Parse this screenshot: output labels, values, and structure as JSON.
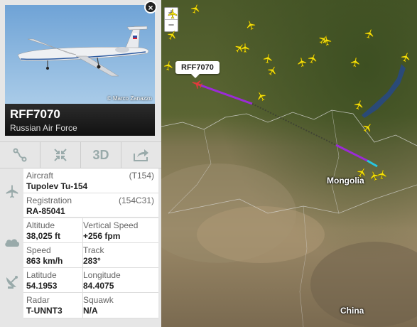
{
  "map": {
    "zoom_in": "+",
    "zoom_out": "−",
    "flight_label": "RFF7070",
    "countries": [
      {
        "name": "Mongolia"
      },
      {
        "name": "China"
      }
    ]
  },
  "panel": {
    "close": "×",
    "photo_credit": "© Marco Zanazzo",
    "callsign": "RFF7070",
    "airline": "Russian Air Force",
    "toolbar": {
      "route_icon": "route-icon",
      "fit_icon": "fit-view-icon",
      "three_d": "3D",
      "share_icon": "share-icon"
    },
    "aircraft": {
      "label": "Aircraft",
      "code": "(T154)",
      "value": "Tupolev Tu-154"
    },
    "registration": {
      "label": "Registration",
      "code": "(154C31)",
      "value": "RA-85041"
    },
    "altitude": {
      "label": "Altitude",
      "value": "38,025 ft"
    },
    "vertical_speed": {
      "label": "Vertical Speed",
      "value": "+256 fpm"
    },
    "speed": {
      "label": "Speed",
      "value": "863 km/h"
    },
    "track": {
      "label": "Track",
      "value": "283°"
    },
    "latitude": {
      "label": "Latitude",
      "value": "54.1953"
    },
    "longitude": {
      "label": "Longitude",
      "value": "84.4075"
    },
    "radar": {
      "label": "Radar",
      "value": "T-UNNT3"
    },
    "squawk": {
      "label": "Squawk",
      "value": "N/A"
    }
  },
  "colors": {
    "track_purple": "#9b2bd6",
    "track_cyan": "#27c6e0",
    "plane_yellow": "#f5e20a"
  }
}
